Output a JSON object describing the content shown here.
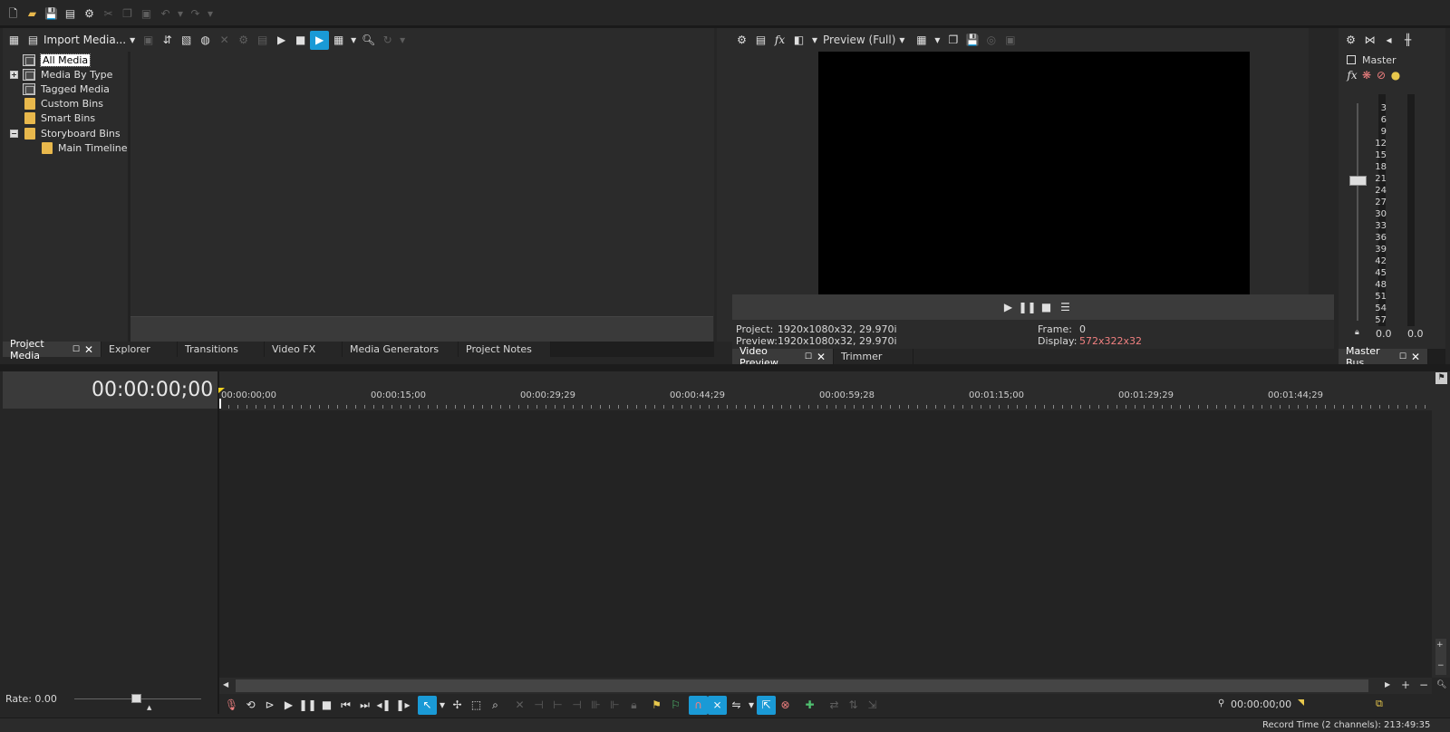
{
  "media_panel": {
    "import_label": "Import Media...",
    "tree": [
      "All Media",
      "Media By Type",
      "Tagged Media",
      "Custom Bins",
      "Smart Bins",
      "Storyboard Bins",
      "Main Timeline"
    ],
    "tabs": [
      "Project Media",
      "Explorer",
      "Transitions",
      "Video FX",
      "Media Generators",
      "Project Notes"
    ]
  },
  "preview_panel": {
    "quality": "Preview (Full)",
    "project_label": "Project:",
    "project_value": "1920x1080x32, 29.970i",
    "preview_label": "Preview:",
    "preview_value": "1920x1080x32, 29.970i",
    "frame_label": "Frame:",
    "frame_value": "0",
    "display_label": "Display:",
    "display_value": "572x322x32",
    "tabs": [
      "Video Preview",
      "Trimmer"
    ],
    "colors": {
      "display_value": "#f08080"
    }
  },
  "master_bus": {
    "title": "Master",
    "db_scale": [
      "3",
      "6",
      "9",
      "12",
      "15",
      "18",
      "21",
      "24",
      "27",
      "30",
      "33",
      "36",
      "39",
      "42",
      "45",
      "48",
      "51",
      "54",
      "57"
    ],
    "left_value": "0.0",
    "right_value": "0.0",
    "tab": "Master Bus"
  },
  "timeline": {
    "timecode": "00:00:00;00",
    "ruler": [
      "00:00:00;00",
      "00:00:15;00",
      "00:00:29;29",
      "00:00:44;29",
      "00:00:59;28",
      "00:01:15;00",
      "00:01:29;29",
      "00:01:44;29"
    ],
    "rate": "Rate: 0.00",
    "cursor_time": "00:00:00;00",
    "record_time": "Record Time (2 channels): 213:49:35"
  },
  "icons": {
    "accent": "#1a9ad6"
  }
}
